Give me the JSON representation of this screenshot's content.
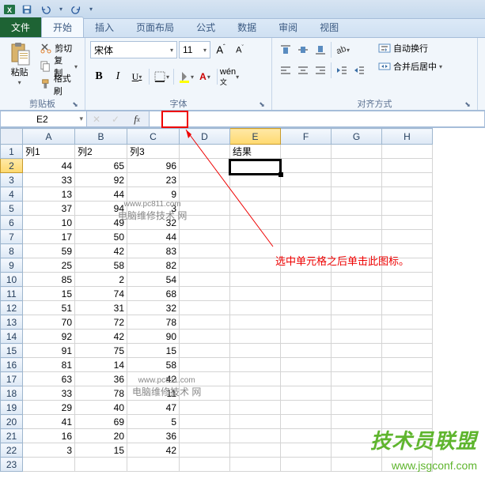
{
  "qat": {
    "save": "保存",
    "undo": "撤销",
    "redo": "重做"
  },
  "tabs": {
    "file": "文件",
    "items": [
      "开始",
      "插入",
      "页面布局",
      "公式",
      "数据",
      "审阅",
      "视图"
    ],
    "active": 0
  },
  "ribbon": {
    "clipboard": {
      "title": "剪贴板",
      "paste": "粘贴",
      "cut": "剪切",
      "copy": "复制",
      "format_painter": "格式刷"
    },
    "font": {
      "title": "字体",
      "name": "宋体",
      "size": "11",
      "bold": "B",
      "italic": "I",
      "underline": "U"
    },
    "align": {
      "title": "对齐方式",
      "wrap": "自动换行",
      "merge": "合并后居中"
    }
  },
  "name_box": "E2",
  "columns": [
    "A",
    "B",
    "C",
    "D",
    "E",
    "F",
    "G",
    "H"
  ],
  "headers": {
    "a": "列1",
    "b": "列2",
    "c": "列3",
    "e": "结果"
  },
  "chart_data": {
    "type": "table",
    "columns": [
      "列1",
      "列2",
      "列3"
    ],
    "rows": [
      [
        44,
        65,
        96
      ],
      [
        33,
        92,
        23
      ],
      [
        13,
        44,
        9
      ],
      [
        37,
        94,
        3
      ],
      [
        10,
        49,
        32
      ],
      [
        17,
        50,
        44
      ],
      [
        59,
        42,
        83
      ],
      [
        25,
        58,
        82
      ],
      [
        85,
        2,
        54
      ],
      [
        15,
        74,
        68
      ],
      [
        51,
        31,
        32
      ],
      [
        70,
        72,
        78
      ],
      [
        92,
        42,
        90
      ],
      [
        91,
        75,
        15
      ],
      [
        81,
        14,
        58
      ],
      [
        63,
        36,
        42
      ],
      [
        33,
        78,
        11
      ],
      [
        29,
        40,
        47
      ],
      [
        41,
        69,
        5
      ],
      [
        16,
        20,
        36
      ],
      [
        3,
        15,
        42
      ]
    ]
  },
  "annotation": "选中单元格之后单击此图标。",
  "watermarks": {
    "w1a": "www.pc811.com",
    "w1b": "电脑维修技术 网",
    "w2a": "www.pc811.com",
    "w2b": "电脑维修技术 网"
  },
  "logo": {
    "text": "技术员联盟",
    "url": "www.jsgconf.com"
  }
}
